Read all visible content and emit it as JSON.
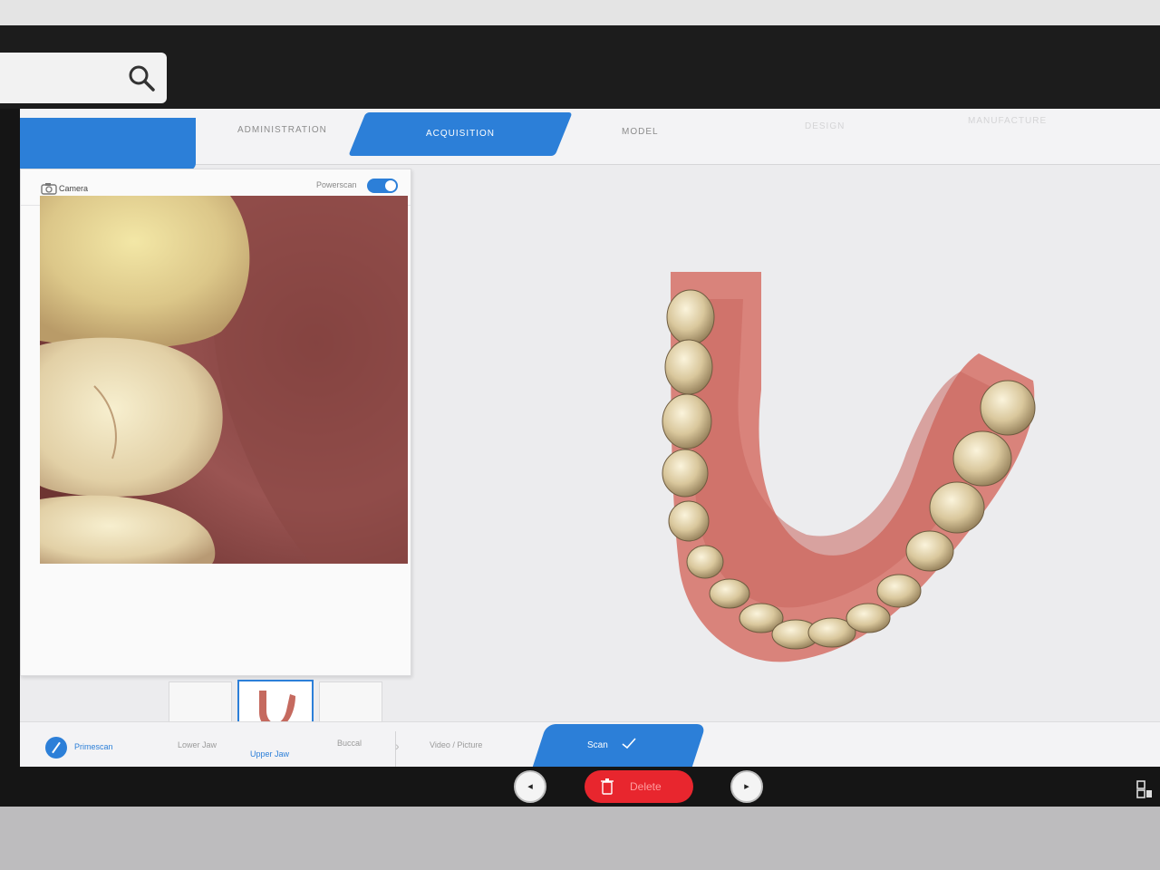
{
  "search": {
    "icon": "search-icon"
  },
  "tabs": {
    "administration": "ADMINISTRATION",
    "acquisition": "ACQUISITION",
    "model": "MODEL",
    "design": "DESIGN",
    "manufacture": "MANUFACTURE"
  },
  "camera": {
    "label": "Camera",
    "powerscan_label": "Powerscan",
    "powerscan_enabled": true
  },
  "steps": {
    "device": "Primescan",
    "lower_jaw": "Lower Jaw",
    "upper_jaw": "Upper Jaw",
    "buccal": "Buccal",
    "video_picture": "Video / Picture",
    "scan": "Scan"
  },
  "actions": {
    "prev": "◂",
    "delete": "Delete",
    "next": "▸"
  },
  "colors": {
    "accent": "#2c7fd8",
    "delete": "#e8262e"
  }
}
